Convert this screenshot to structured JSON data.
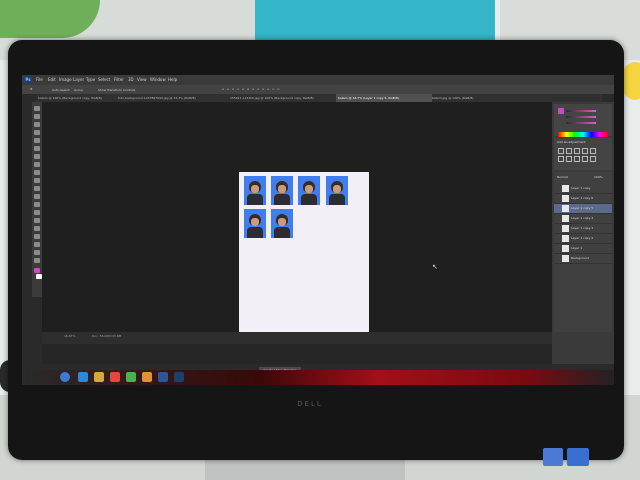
{
  "photoshop": {
    "app_icon": "Ps",
    "menu": [
      "File",
      "Edit",
      "Image",
      "Layer",
      "Type",
      "Select",
      "Filter",
      "3D",
      "View",
      "Window",
      "Help"
    ],
    "document_tabs": [
      "batam @ 100% (Background copy, RGB/8)",
      "foto-background-123789709d.jpg @ 33.3% (RGB/8)",
      "155017-1133hh.jpg @ 100% (Background copy, RGB/8)",
      "batam @ 16.7% (Layer 1 copy 5, RGB/8)",
      "batam.jpg @ 100% (RGB/8)"
    ],
    "options": {
      "auto_select": "Auto-Select:",
      "group": "Group",
      "transform": "Show Transform Controls"
    },
    "status": {
      "zoom": "16.67%",
      "doc": "Doc: 56.0M/133.6M"
    },
    "timeline_button": "Create Video Timeline",
    "panels": {
      "adjustments_label": "Add an adjustment",
      "blend_mode": "Normal",
      "opacity": "100%",
      "layers": [
        "Layer 1 copy",
        "Layer 1 copy 6",
        "Layer 1 copy 5",
        "Layer 1 copy 4",
        "Layer 1 copy 3",
        "Layer 1 copy 2",
        "Layer 1",
        "Background"
      ],
      "selected_layer_index": 2
    }
  },
  "colors": {
    "photo_background": "#3e7ef0",
    "taskbar_accent": "#a30f18",
    "canvas_bg": "#1f1f1f"
  }
}
